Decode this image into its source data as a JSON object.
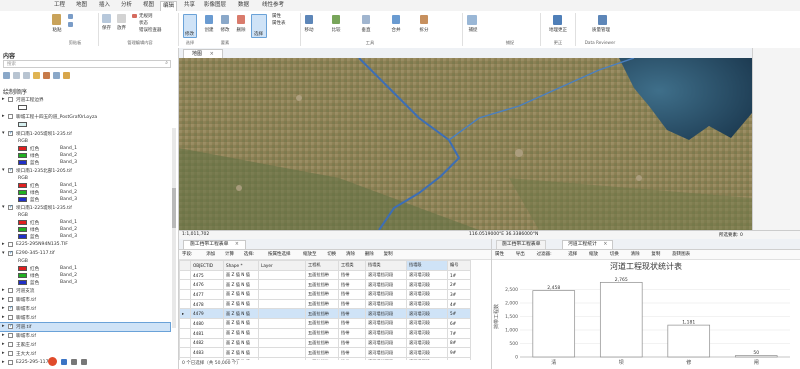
{
  "ribbon_tabs": [
    "工程",
    "地图",
    "插入",
    "分析",
    "视图",
    "编辑",
    "共享",
    "影像图层",
    "数据",
    "线性参考"
  ],
  "active_tab": "编辑",
  "ribbon": {
    "buttons_left": [
      "粘贴",
      "剪切",
      "复制",
      "复制路径"
    ],
    "clipboard_group": "剪贴板",
    "edit_btns": [
      "保存",
      "放弃",
      "撤销"
    ],
    "edit_list": [
      "无规则",
      "状态",
      "错误检查器"
    ],
    "manage_group": "管理编辑内容",
    "modify": "修改",
    "select_group": "选择",
    "select_btns": [
      "创建",
      "修改",
      "删除"
    ],
    "elements_group": "要素",
    "tool_items": [
      "属性",
      "属性表",
      "选择"
    ],
    "tools": [
      "移动",
      "比较",
      "垂直",
      "合并",
      "拆分"
    ],
    "tools_group": "工具",
    "snapping": "捕捉",
    "snapping_group": "捕捉",
    "correction_group": "更正",
    "ds_btns": [
      "地理数据库",
      "质量管理"
    ],
    "ds_group": "Data Reviewer",
    "correction_btn": "地理更正"
  },
  "contents": {
    "title": "内容",
    "search_placeholder": "搜索",
    "drawing_order": "绘制顺序",
    "layers": [
      {
        "name": "河道工程边界",
        "checked": false,
        "indent": 1,
        "has_swatch": true
      },
      {
        "name": "聊城工程十四五的道_PostGraf0rLoyza",
        "checked": false,
        "indent": 1,
        "has_swatch": true
      },
      {
        "name": "坝口南1-205堤坝1-235.tif",
        "checked": true,
        "indent": 1,
        "bands": true
      },
      {
        "name": "坝口南1-235北部1-205.tif",
        "checked": true,
        "indent": 1,
        "bands": true
      },
      {
        "name": "坝口南1-225堤坝1-235.tif",
        "checked": true,
        "indent": 1,
        "bands": true
      },
      {
        "name": "E225-295N94N135.TIF",
        "checked": false,
        "indent": 1
      },
      {
        "name": "E290-345-117.tif",
        "checked": true,
        "indent": 1,
        "bands": true
      },
      {
        "name": "河道支流",
        "checked": false,
        "indent": 1
      },
      {
        "name": "聊城市.tif",
        "checked": false,
        "indent": 1
      },
      {
        "name": "聊城市.tif",
        "checked": true,
        "indent": 1
      },
      {
        "name": "聊城市.tif",
        "checked": false,
        "indent": 1
      },
      {
        "name": "河道.tif",
        "checked": true,
        "indent": 1,
        "selected": true
      },
      {
        "name": "聊城市.tif",
        "checked": false,
        "indent": 1
      },
      {
        "name": "王家庄.tif",
        "checked": false,
        "indent": 1
      },
      {
        "name": "王大大.tif",
        "checked": false,
        "indent": 1
      },
      {
        "name": "E225-295-117.tif",
        "checked": false,
        "indent": 1
      },
      {
        "name": "E290-373-117.tif",
        "checked": false,
        "indent": 1
      },
      {
        "name": "E300-340-117.tif",
        "checked": true,
        "indent": 1
      }
    ],
    "band_labels": [
      "红色",
      "绿色",
      "蓝色"
    ],
    "band_values": [
      "Band_1",
      "Band_2",
      "Band_3"
    ],
    "band_header": "RGB"
  },
  "map": {
    "tab_label": "地图",
    "scale": "1:1,011,702",
    "coords": "116.0519000°E 36.3386000°N",
    "selected": "所选要素: 0"
  },
  "table_panel": {
    "tab_label": "施工挡带工程表单",
    "toolbar": [
      "字段:",
      "添加",
      "计算",
      "选择:",
      "按属性选择",
      "缩放至",
      "切换",
      "清除",
      "删除",
      "复制"
    ],
    "columns": [
      "OBJECTID",
      "Shape *",
      "Layer",
      "工程机",
      "工程类",
      "挡墙类",
      "挡墙段",
      "编号"
    ],
    "rows": [
      [
        "4475",
        "面 Z 值 Ν 值",
        "",
        "五面拉挡带",
        "挡带",
        "滚河墙挡河段",
        "滚河墙河段",
        "1#"
      ],
      [
        "4476",
        "面 Z 值 Ν 值",
        "",
        "五面拉挡带",
        "挡带",
        "滚河墙挡河段",
        "滚河墙河段",
        "2#"
      ],
      [
        "4477",
        "面 Z 值 Ν 值",
        "",
        "五面拉挡带",
        "挡带",
        "滚河墙挡河段",
        "滚河墙河段",
        "3#"
      ],
      [
        "4478",
        "面 Z 值 Ν 值",
        "",
        "五面拉挡带",
        "挡带",
        "滚河墙挡河段",
        "滚河墙河段",
        "4#"
      ],
      [
        "4479",
        "面 Z 值 Ν 值",
        "",
        "五面拉挡带",
        "挡带",
        "滚河墙挡河段",
        "滚河墙河段",
        "5#"
      ],
      [
        "4480",
        "面 Z 值 Ν 值",
        "",
        "五面拉挡带",
        "挡带",
        "滚河墙挡河段",
        "滚河墙河段",
        "6#"
      ],
      [
        "4481",
        "面 Z 值 Ν 值",
        "",
        "五面拉挡带",
        "挡带",
        "滚河墙挡河段",
        "滚河墙河段",
        "7#"
      ],
      [
        "4482",
        "面 Z 值 Ν 值",
        "",
        "五面拉挡带",
        "挡带",
        "滚河墙挡河段",
        "滚河墙河段",
        "8#"
      ],
      [
        "4483",
        "面 Z 值 Ν 值",
        "",
        "五面拉挡带",
        "挡带",
        "滚河墙挡河段",
        "滚河墙河段",
        "9#"
      ],
      [
        "4484",
        "面 Z 值 Ν 值",
        "",
        "五面拉挡带",
        "挡带",
        "滚河墙挡河段",
        "滚河墙河段",
        "10#"
      ]
    ],
    "selected_row": 4,
    "footer": "0 个已选择（共 50,000 个）"
  },
  "chart_panel": {
    "tabs": [
      "施工挡带工程表单",
      "河道工程统计"
    ],
    "toolbar": [
      "属性",
      "导出",
      "过滤器:",
      "选择",
      "缩放",
      "切换",
      "清除",
      "复制",
      "旋转图表"
    ]
  },
  "chart_data": {
    "type": "bar",
    "title": "河道工程现状统计表",
    "ylabel": "挡带工程数",
    "categories": [
      "清",
      "坝",
      "修",
      "闸"
    ],
    "values": [
      2458,
      2765,
      1181,
      50
    ],
    "value_labels": [
      "2,458",
      "2,765",
      "1,181",
      "50"
    ],
    "ylim": [
      0,
      3000
    ],
    "yticks": [
      "0",
      "500",
      "1,000",
      "1,500",
      "2,000",
      "2,500"
    ],
    "grid": true,
    "colors": {
      "bar_fill": "#ffffff",
      "bar_stroke": "#8c8c8c"
    }
  }
}
